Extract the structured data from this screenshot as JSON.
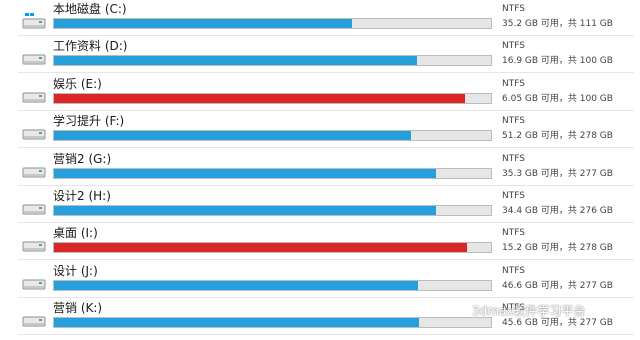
{
  "drives": [
    {
      "name": "本地磁盘 (C:)",
      "fs": "NTFS",
      "space": "35.2 GB 可用，共 111 GB",
      "used_fraction": 0.683,
      "icon": "windows-drive-icon",
      "bar_color": "#26a0da"
    },
    {
      "name": "工作资料 (D:)",
      "fs": "NTFS",
      "space": "16.9 GB 可用，共 100 GB",
      "used_fraction": 0.831,
      "icon": "drive-icon",
      "bar_color": "#26a0da"
    },
    {
      "name": "娱乐 (E:)",
      "fs": "NTFS",
      "space": "6.05 GB 可用，共 100 GB",
      "used_fraction": 0.94,
      "icon": "drive-icon",
      "bar_color": "#da2626"
    },
    {
      "name": "学习提升 (F:)",
      "fs": "NTFS",
      "space": "51.2 GB 可用，共 278 GB",
      "used_fraction": 0.816,
      "icon": "drive-icon",
      "bar_color": "#26a0da"
    },
    {
      "name": "营销2 (G:)",
      "fs": "NTFS",
      "space": "35.3 GB 可用，共 277 GB",
      "used_fraction": 0.873,
      "icon": "drive-icon",
      "bar_color": "#26a0da"
    },
    {
      "name": "设计2 (H:)",
      "fs": "NTFS",
      "space": "34.4 GB 可用，共 276 GB",
      "used_fraction": 0.875,
      "icon": "drive-icon",
      "bar_color": "#26a0da"
    },
    {
      "name": "桌面 (I:)",
      "fs": "NTFS",
      "space": "15.2 GB 可用，共 278 GB",
      "used_fraction": 0.945,
      "icon": "drive-icon",
      "bar_color": "#da2626"
    },
    {
      "name": "设计 (J:)",
      "fs": "NTFS",
      "space": "46.6 GB 可用，共 277 GB",
      "used_fraction": 0.832,
      "icon": "drive-icon",
      "bar_color": "#26a0da"
    },
    {
      "name": "营销 (K:)",
      "fs": "NTFS",
      "space": "45.6 GB 可用，共 277 GB",
      "used_fraction": 0.835,
      "icon": "drive-icon",
      "bar_color": "#26a0da"
    }
  ],
  "watermark": {
    "text": "3dmax软件学习平台",
    "icon": "wechat-icon"
  }
}
